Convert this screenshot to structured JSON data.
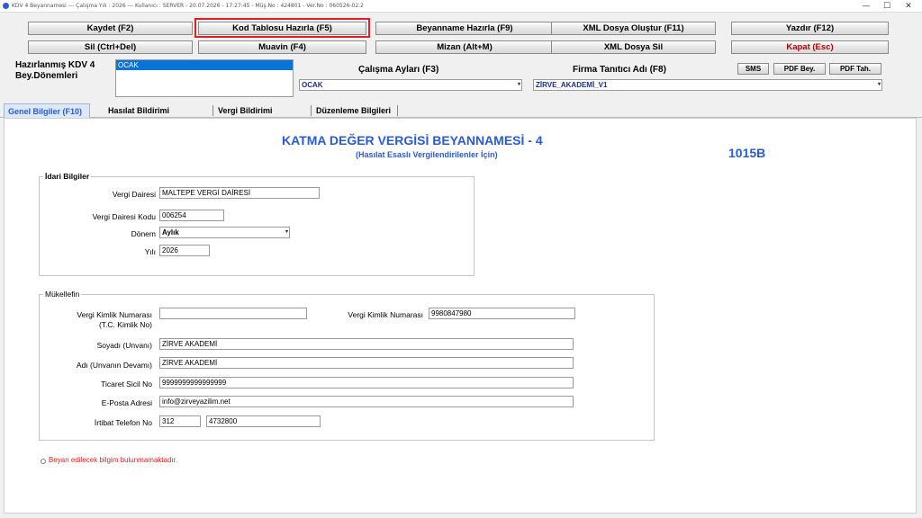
{
  "window": {
    "title": "KDV 4 Beyannamesi  ---  Çalışma Yılı : 2026  ---  Kullanıcı : SERVER - 20.07.2026 - 17:27:45  -  Müş.No : 424801  -  Ver.No : 060526-02.2",
    "minimize": "—",
    "maximize": "☐",
    "close": "✕"
  },
  "toolbar": {
    "kaydet": "Kaydet (F2)",
    "kod_tablosu": "Kod Tablosu Hazırla (F5)",
    "beyanname_hazirla": "Beyanname Hazırla (F9)",
    "xml_olustur": "XML Dosya Oluştur (F11)",
    "yazdir": "Yazdır (F12)",
    "sil": "Sil (Ctrl+Del)",
    "muavin": "Muavin (F4)",
    "mizan": "Mizan (Alt+M)",
    "xml_sil": "XML Dosya Sil",
    "kapat": "Kapat (Esc)"
  },
  "periods": {
    "label_line1": "Hazırlanmış KDV 4",
    "label_line2": "Bey.Dönemleri",
    "items": [
      "OCAK"
    ],
    "calisma_aylari_label": "Çalışma Ayları (F3)",
    "calisma_aylari_value": "OCAK",
    "firma_label": "Firma Tanıtıcı Adı (F8)",
    "firma_value": "ZİRVE_AKADEMİ_V1",
    "sms": "SMS",
    "pdf_bey": "PDF Bey.",
    "pdf_tah": "PDF Tah."
  },
  "tabs": [
    {
      "label": "Genel Bilgiler (F10)"
    },
    {
      "label": "Hasılat Bildirimi"
    },
    {
      "label": "Vergi Bildirimi"
    },
    {
      "label": "Düzenleme Bilgileri"
    }
  ],
  "form": {
    "title": "KATMA  DEĞER VERGİSİ BEYANNAMESİ - 4",
    "subtitle": "(Hasılat Esaslı Vergilendirilenler İçin)",
    "code": "1015B",
    "idari": {
      "legend": "İdari Bilgiler",
      "vergi_dairesi_label": "Vergi Dairesi",
      "vergi_dairesi": "MALTEPE VERGİ DAİRESİ",
      "vergi_dairesi_kodu_label": "Vergi Dairesi Kodu",
      "vergi_dairesi_kodu": "006254",
      "donem_label": "Dönem",
      "donem": "Aylık",
      "yil_label": "Yılı",
      "yil": "2026"
    },
    "mukellef": {
      "legend": "Mükellefin",
      "tckn_label_1": "Vergi Kimlik Numarası",
      "tckn_label_2": "(T.C. Kimlik No)",
      "tckn": "",
      "vkn_label": "Vergi Kimlik Numarası",
      "vkn": "9980847980",
      "soyadi_label": "Soyadı (Unvanı)",
      "soyadi": "ZİRVE AKADEMİ",
      "adi_label": "Adı (Unvanın Devamı)",
      "adi": "ZİRVE AKADEMİ",
      "ticaret_label": "Ticaret Sicil No",
      "ticaret": "9999999999999999",
      "eposta_label": "E-Posta Adresi",
      "eposta": "info@zirveyazilim.net",
      "telefon_label": "İrtibat Telefon No",
      "telefon_kod": "312",
      "telefon_no": "4732800"
    },
    "note": "Beyan edilecek bilgim bulunmamaktadır."
  },
  "colors": {
    "accent_blue": "#2a5bd7",
    "danger_red": "#e02020",
    "selection": "#0a73d8"
  }
}
